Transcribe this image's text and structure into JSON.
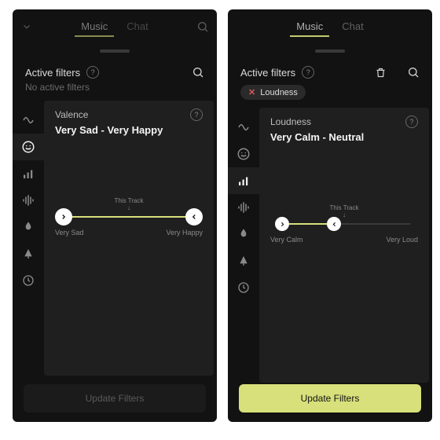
{
  "common": {
    "this_track": "This Track",
    "update_btn": "Update Filters"
  },
  "left": {
    "top": {
      "tab_music": "Music",
      "tab_chat": "Chat"
    },
    "filters": {
      "title": "Active filters",
      "empty": "No active filters"
    },
    "attr": {
      "name": "Valence",
      "range": "Very Sad - Very Happy",
      "min_label": "Very Sad",
      "max_label": "Very Happy"
    },
    "sidebar_icons": [
      "tempo",
      "valence",
      "loudness",
      "waveform",
      "energy",
      "instrument",
      "time"
    ],
    "sidebar_selected": "valence",
    "update_enabled": false
  },
  "right": {
    "top": {
      "tab_music": "Music",
      "tab_chat": "Chat"
    },
    "filters": {
      "title": "Active filters",
      "chips": [
        "Loudness"
      ]
    },
    "attr": {
      "name": "Loudness",
      "range": "Very Calm - Neutral",
      "min_label": "Very Calm",
      "max_label": "Very Loud"
    },
    "sidebar_icons": [
      "tempo",
      "valence",
      "loudness",
      "waveform",
      "energy",
      "instrument",
      "time"
    ],
    "sidebar_selected": "loudness",
    "update_enabled": true
  },
  "colors": {
    "accent": "#d7e07a",
    "bg": "#121212",
    "panel": "#1f1f1f",
    "danger": "#d05a5a"
  }
}
